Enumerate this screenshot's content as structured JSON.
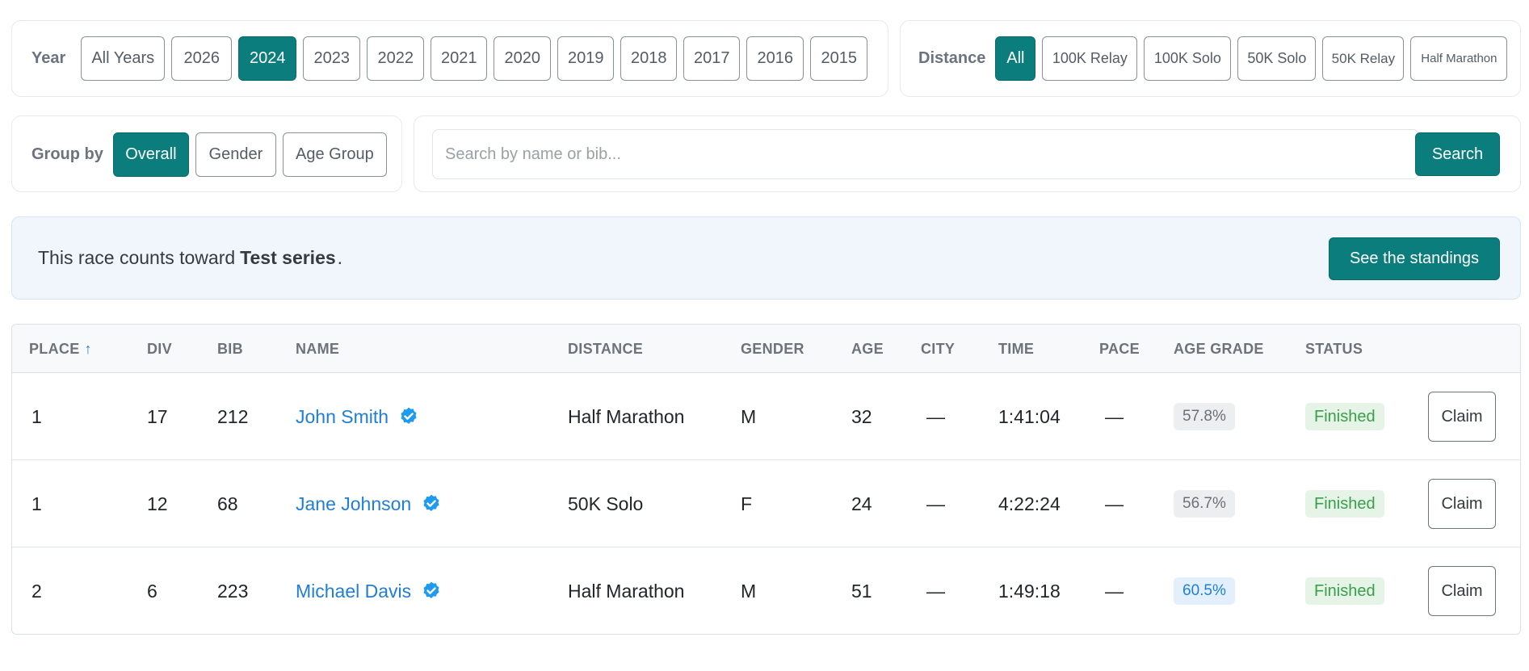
{
  "year_filter": {
    "label": "Year",
    "options": [
      "All Years",
      "2026",
      "2024",
      "2023",
      "2022",
      "2021",
      "2020",
      "2019",
      "2018",
      "2017",
      "2016",
      "2015"
    ],
    "selected": "2024"
  },
  "distance_filter": {
    "label": "Distance",
    "options": [
      "All",
      "100K Relay",
      "100K Solo",
      "50K Solo",
      "50K Relay",
      "Half Marathon"
    ],
    "selected": "All"
  },
  "group_by": {
    "label": "Group by",
    "options": [
      "Overall",
      "Gender",
      "Age Group"
    ],
    "selected": "Overall"
  },
  "search": {
    "placeholder": "Search by name or bib...",
    "button_label": "Search"
  },
  "banner": {
    "text_before": "This race counts toward",
    "series_name": "Test series",
    "text_after": ".",
    "button_label": "See the standings"
  },
  "table": {
    "columns": [
      "PLACE",
      "DIV",
      "BIB",
      "NAME",
      "DISTANCE",
      "GENDER",
      "AGE",
      "CITY",
      "TIME",
      "PACE",
      "AGE GRADE",
      "STATUS"
    ],
    "sort_column": "PLACE",
    "sort_direction": "ascending",
    "rows": [
      {
        "place": "1",
        "div": "17",
        "bib": "212",
        "name": "John Smith",
        "verified": true,
        "distance": "Half Marathon",
        "gender": "M",
        "age": "32",
        "city": "—",
        "time": "1:41:04",
        "pace": "—",
        "age_grade": "57.8%",
        "status": "Finished",
        "action": "Claim"
      },
      {
        "place": "1",
        "div": "12",
        "bib": "68",
        "name": "Jane Johnson",
        "verified": true,
        "distance": "50K Solo",
        "gender": "F",
        "age": "24",
        "city": "—",
        "time": "4:22:24",
        "pace": "—",
        "age_grade": "56.7%",
        "status": "Finished",
        "action": "Claim"
      },
      {
        "place": "2",
        "div": "6",
        "bib": "223",
        "name": "Michael Davis",
        "verified": true,
        "distance": "Half Marathon",
        "gender": "M",
        "age": "51",
        "city": "—",
        "time": "1:49:18",
        "pace": "—",
        "age_grade": "60.5%",
        "status": "Finished",
        "action": "Claim"
      }
    ]
  },
  "colors": {
    "accent": "#0b7d7d",
    "link": "#1f7fd6",
    "status_finished_bg": "#e6f4e8",
    "status_finished_text": "#3a9e4a",
    "age_grade_highlight_bg": "#e3f0fc"
  },
  "icons": {
    "sort": "arrow-up-icon",
    "verified": "verified-badge-icon"
  }
}
